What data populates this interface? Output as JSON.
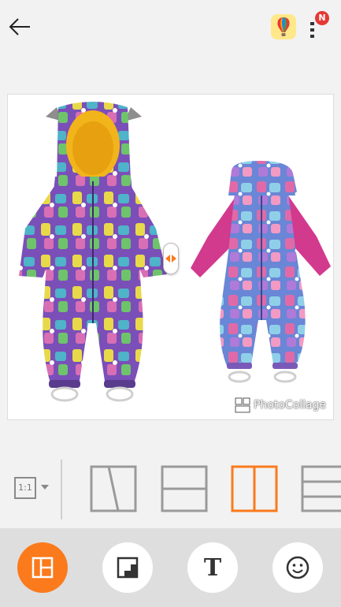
{
  "top_bar": {
    "back_icon": "arrow-left-icon",
    "balloon_icon": "hot-air-balloon-icon",
    "more_icon": "more-vertical-icon",
    "notification_badge": "N"
  },
  "collage": {
    "left_image": "purple-kids-snowsuit-with-hood",
    "right_image": "blue-pink-kids-snowsuit",
    "divider_icon": "swap-arrows-icon",
    "watermark_text": "PhotoCollage"
  },
  "layout_strip": {
    "ratio_label": "1:1",
    "options": [
      {
        "name": "diagonal-split",
        "selected": false
      },
      {
        "name": "horizontal-split",
        "selected": false
      },
      {
        "name": "vertical-split",
        "selected": true
      },
      {
        "name": "three-rows",
        "selected": false
      }
    ]
  },
  "bottom_toolbar": {
    "tools": [
      {
        "name": "layout",
        "icon": "layout-grid-icon",
        "active": true
      },
      {
        "name": "border",
        "icon": "frame-corner-icon",
        "active": false
      },
      {
        "name": "text",
        "icon": "text-t-icon",
        "label": "T",
        "active": false
      },
      {
        "name": "sticker",
        "icon": "smiley-icon",
        "active": false
      }
    ]
  },
  "colors": {
    "accent": "#fb7a1c",
    "badge": "#e53935",
    "background": "#f2f2f2",
    "toolbar": "#dedede"
  }
}
